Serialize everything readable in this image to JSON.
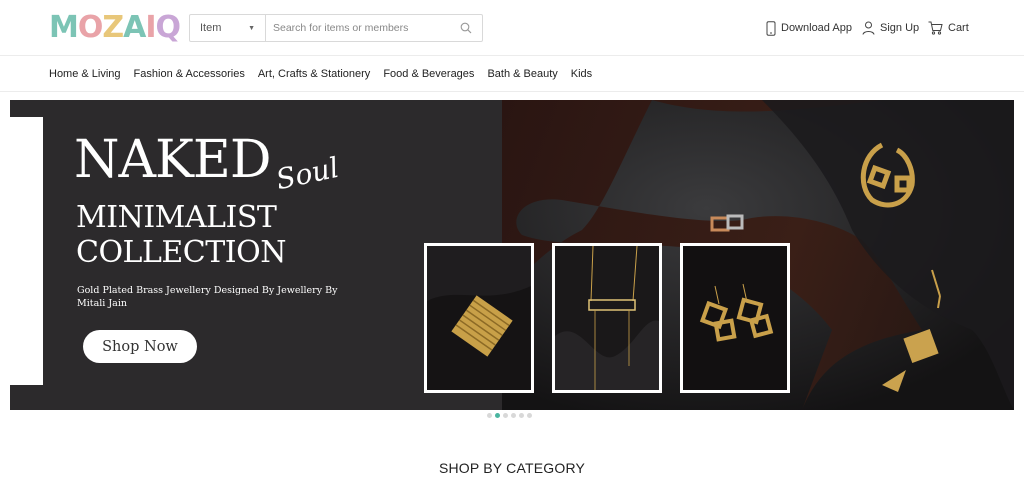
{
  "logo": {
    "text": "MOZAIQ",
    "letters": [
      {
        "char": "M",
        "color": "#7cc4b5"
      },
      {
        "char": "O",
        "color": "#e9a3a8"
      },
      {
        "char": "Z",
        "color": "#e8c77a"
      },
      {
        "char": "A",
        "color": "#7cc4b5"
      },
      {
        "char": "I",
        "color": "#e9a3a8"
      },
      {
        "char": "Q",
        "color": "#c9a6d6"
      }
    ]
  },
  "search": {
    "category": "Item",
    "placeholder": "Search for items or members",
    "icon": "search-icon"
  },
  "header": {
    "download_app": "Download App",
    "sign_up": "Sign Up",
    "cart": "Cart"
  },
  "nav": {
    "items": [
      {
        "label": "Home & Living"
      },
      {
        "label": "Fashion & Accessories"
      },
      {
        "label": "Art, Crafts & Stationery"
      },
      {
        "label": "Food & Beverages"
      },
      {
        "label": "Bath & Beauty"
      },
      {
        "label": "Kids"
      }
    ]
  },
  "banner": {
    "title_1": "NAKED",
    "title_script": "Soul",
    "title_2": "MINIMALIST",
    "title_3": "COLLECTION",
    "description": "Gold Plated Brass Jewellery Designed By Jewellery By Mitali Jain",
    "cta": "Shop Now",
    "carousel": {
      "slides": 6,
      "active": 2
    }
  },
  "section": {
    "title": "SHOP BY CATEGORY"
  },
  "colors": {
    "accent": "#4ab5a0",
    "banner_dark": "#2c2a2c",
    "gold": "#c9a04a"
  }
}
